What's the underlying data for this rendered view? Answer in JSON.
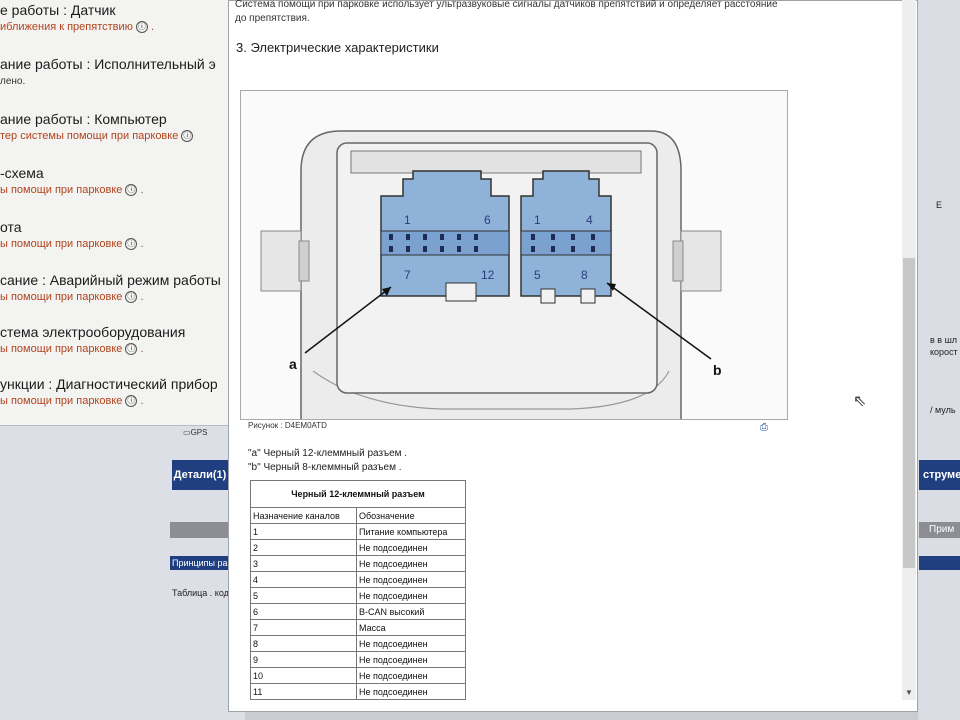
{
  "background_window": {
    "items": [
      {
        "title": "е работы : Датчик",
        "link": "иближения к препятствию"
      },
      {
        "title": "ание работы : Исполнительный э",
        "sub": "лено."
      },
      {
        "title": "ание работы : Компьютер",
        "link": "тер системы помощи при парковке"
      },
      {
        "title": "-схема",
        "link": "ы помощи при парковке"
      },
      {
        "title": "ота",
        "link": "ы помощи при парковке"
      },
      {
        "title": "сание : Аварийный режим работы",
        "link": "ы помощи при парковке"
      },
      {
        "title": "стема электрооборудования",
        "link": "ы помощи при парковке"
      },
      {
        "title": "ункции : Диагностический прибор",
        "link": "ы помощи при парковке"
      }
    ],
    "info_symbol": "ⓘ",
    "gps_label": "GPS",
    "details_tab": "Детали(1)",
    "principles_row": "Принципы работ",
    "table_code": "Таблица . код не"
  },
  "right_strip": {
    "texts": [
      "Е",
      "в в шл",
      "корост",
      "/ муль"
    ],
    "instr_tab": "струме",
    "header": "Прим"
  },
  "document": {
    "intro_line1": "Система помощи при парковке использует ультразвуковые сигналы датчиков препятствий и определяет расстояние",
    "intro_line2": "до препятствия.",
    "section_heading": "3. Электрические характеристики",
    "figure": {
      "caption": "Рисунок : D4EM0ATD",
      "callout_a": "a",
      "callout_b": "b",
      "connector_a": {
        "top_left": "1",
        "top_right": "6",
        "bottom_left": "7",
        "bottom_right": "12"
      },
      "connector_b": {
        "top_left": "1",
        "top_right": "4",
        "bottom_left": "5",
        "bottom_right": "8"
      }
    },
    "description_a": "\"a\" Черный 12-клеммный разъем .",
    "description_b": "\"b\" Черный 8-клеммный разъем .",
    "pin_table": {
      "title": "Черный 12-клеммный разъем",
      "headers": [
        "Назначение каналов",
        "Обозначение"
      ],
      "rows": [
        [
          "1",
          "Питание компьютера"
        ],
        [
          "2",
          "Не подсоединен"
        ],
        [
          "3",
          "Не подсоединен"
        ],
        [
          "4",
          "Не подсоединен"
        ],
        [
          "5",
          "Не подсоединен"
        ],
        [
          "6",
          "B-CAN высокий"
        ],
        [
          "7",
          "Масса"
        ],
        [
          "8",
          "Не подсоединен"
        ],
        [
          "9",
          "Не подсоединен"
        ],
        [
          "10",
          "Не подсоединен"
        ],
        [
          "11",
          "Не подсоединен"
        ]
      ]
    }
  },
  "colors": {
    "connector_fill": "#8fb2d9",
    "link": "#b0441e",
    "nav_blue": "#1f3f80"
  }
}
